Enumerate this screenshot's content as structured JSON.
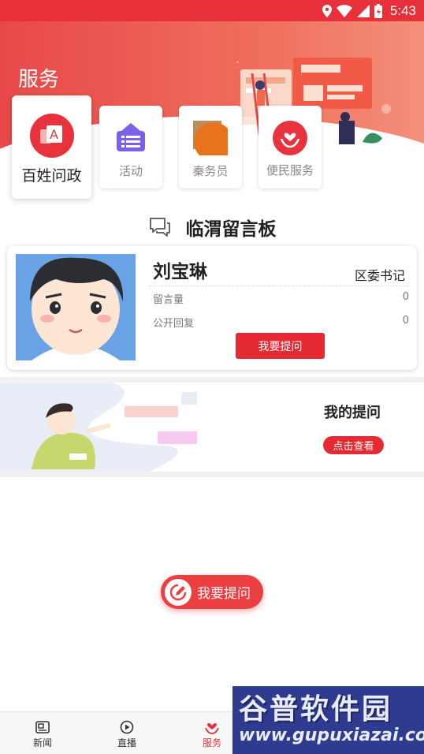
{
  "status_bar": {
    "time": "5:43",
    "icons": [
      "location-icon",
      "wifi-icon",
      "signal-icon",
      "battery-icon"
    ]
  },
  "header": {
    "title": "服务"
  },
  "services": [
    {
      "label": "百姓问政",
      "icon": "petition-icon"
    },
    {
      "label": "活动",
      "icon": "activity-icon"
    },
    {
      "label": "秦务员",
      "icon": "official-icon"
    },
    {
      "label": "便民服务",
      "icon": "service-icon"
    }
  ],
  "board": {
    "title": "临渭留言板"
  },
  "leader": {
    "name": "刘宝琳",
    "title": "区委书记",
    "message_count_label": "留言量",
    "message_count": "0",
    "public_reply_label": "公开回复",
    "public_reply": "0",
    "ask_button": "我要提问"
  },
  "my_questions": {
    "label": "我的提问",
    "button": "点击查看"
  },
  "fab": {
    "label": "我要提问"
  },
  "tabs": [
    {
      "label": "新闻",
      "icon": "news-icon",
      "active": false
    },
    {
      "label": "直播",
      "icon": "live-icon",
      "active": false
    },
    {
      "label": "服务",
      "icon": "service-heart-icon",
      "active": true
    }
  ],
  "watermark": {
    "brand": "谷普软件园",
    "url": "www.gupuxiazai.com"
  },
  "colors": {
    "brand_red": "#e8303b",
    "button_red": "#e52a33",
    "purple": "#7b61e8"
  }
}
